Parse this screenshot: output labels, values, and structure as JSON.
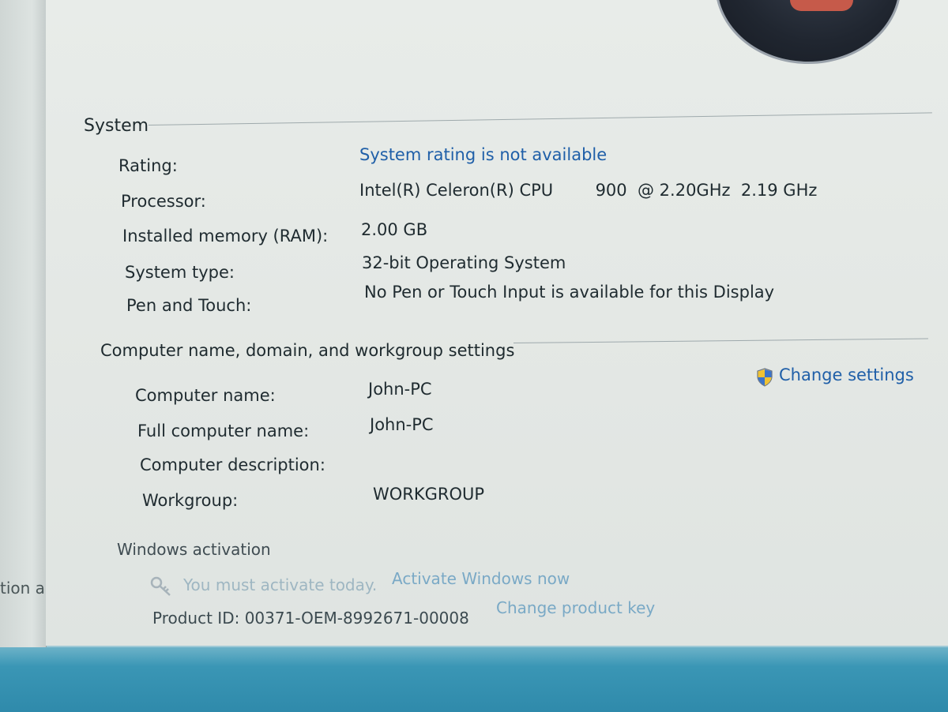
{
  "sidebar": {
    "partial_text": "tion and"
  },
  "system": {
    "heading": "System",
    "rows": [
      {
        "label": "Rating:",
        "value": "System rating is not available",
        "is_link": true
      },
      {
        "label": "Processor:",
        "value": "Intel(R) Celeron(R) CPU        900  @ 2.20GHz  2.19 GHz"
      },
      {
        "label": "Installed memory (RAM):",
        "value": "2.00 GB"
      },
      {
        "label": "System type:",
        "value": "32-bit Operating System"
      },
      {
        "label": "Pen and Touch:",
        "value": "No Pen or Touch Input is available for this Display"
      }
    ]
  },
  "computer": {
    "heading": "Computer name, domain, and workgroup settings",
    "change_settings": "Change settings",
    "rows": [
      {
        "label": "Computer name:",
        "value": "John-PC"
      },
      {
        "label": "Full computer name:",
        "value": "John-PC"
      },
      {
        "label": "Computer description:",
        "value": ""
      },
      {
        "label": "Workgroup:",
        "value": "WORKGROUP"
      }
    ]
  },
  "activation": {
    "heading": "Windows activation",
    "status_text": "You must activate today.",
    "activate_link": "Activate Windows now",
    "product_id": "Product ID: 00371-OEM-8992671-00008",
    "change_key_link": "Change product key"
  },
  "colors": {
    "link": "#1f5fa8",
    "panel_bg": "#e4e8e5",
    "taskbar": "#3a96b5"
  },
  "icons": {
    "shield": "uac-shield-icon",
    "key": "activation-key-icon"
  }
}
